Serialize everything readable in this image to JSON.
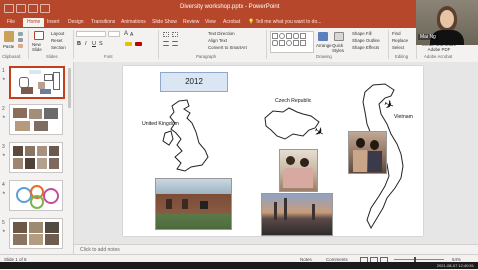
{
  "window": {
    "title": "Diversity workshop.pptx - PowerPoint"
  },
  "tabs": [
    "File",
    "Home",
    "Insert",
    "Design",
    "Transitions",
    "Animations",
    "Slide Show",
    "Review",
    "View",
    "Acrobat"
  ],
  "tell_me": "Tell me what you want to do...",
  "ribbon": {
    "paste": "Paste",
    "new_slide": "New Slide",
    "layout": "Layout",
    "reset": "Reset",
    "section": "Section",
    "font_size_down_label": "A",
    "text_direction": "Text Direction",
    "align_text": "Align Text",
    "convert_smartart": "Convert to SmartArt",
    "arrange": "Arrange",
    "quick_styles": "Quick Styles",
    "shape_fill": "Shape Fill",
    "shape_outline": "Shape Outline",
    "shape_effects": "Shape Effects",
    "find": "Find",
    "replace": "Replace",
    "select": "Select",
    "share_pdf": "Create and Share Adobe PDF",
    "groups": [
      "Clipboard",
      "Slides",
      "Font",
      "Paragraph",
      "Drawing",
      "Editing",
      "Adobe Acrobat"
    ]
  },
  "user": {
    "name": "Mai Ng"
  },
  "thumbnails": [
    {
      "num": "1",
      "selected": true
    },
    {
      "num": "2",
      "selected": false
    },
    {
      "num": "3",
      "selected": false
    },
    {
      "num": "4",
      "selected": false
    },
    {
      "num": "5",
      "selected": false
    }
  ],
  "slide": {
    "year": "2012",
    "labels": {
      "uk": "United Kingdom",
      "cz": "Czech Republic",
      "vn": "Vietnam"
    }
  },
  "notes_placeholder": "Click to add notes",
  "status": {
    "slide_info": "Slide 1 of 8",
    "notes_btn": "Notes",
    "comments_btn": "Comments",
    "zoom": "54%"
  },
  "taskbar_clock": "2021-08-07  12:40:51"
}
